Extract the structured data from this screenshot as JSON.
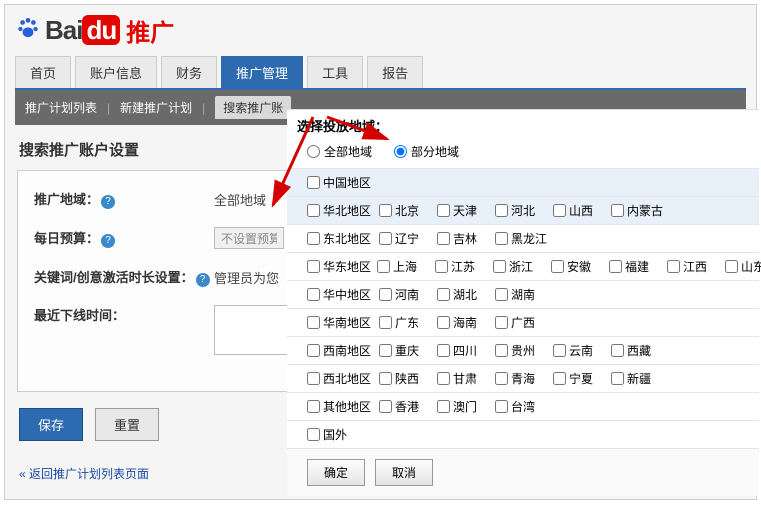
{
  "logo": {
    "bai": "Bai",
    "du": "du",
    "tuiguang": "推广"
  },
  "mainNav": [
    "首页",
    "账户信息",
    "财务",
    "推广管理",
    "工具",
    "报告"
  ],
  "mainNavActive": 3,
  "subNav": {
    "item1": "推广计划列表",
    "item2": "新建推广计划",
    "tab": "搜索推广账"
  },
  "sectionTitle": "搜索推广账户设置",
  "settings": {
    "regionLabel": "推广地域：",
    "regionValue": "全部地域",
    "budgetLabel": "每日预算：",
    "budgetValue": "不设置预算",
    "keywordLabel": "关键词/创意激活时长设置：",
    "keywordValue": "管理员为您",
    "offlineLabel": "最近下线时间："
  },
  "buttons": {
    "save": "保存",
    "reset": "重置"
  },
  "backLink": "« 返回推广计划列表页面",
  "popup": {
    "title": "选择投放地域：",
    "radioAll": "全部地域",
    "radioPart": "部分地域",
    "chinaRegion": "中国地区",
    "regions": [
      {
        "name": "华北地区",
        "cities": [
          "北京",
          "天津",
          "河北",
          "山西",
          "内蒙古"
        ]
      },
      {
        "name": "东北地区",
        "cities": [
          "辽宁",
          "吉林",
          "黑龙江"
        ]
      },
      {
        "name": "华东地区",
        "cities": [
          "上海",
          "江苏",
          "浙江",
          "安徽",
          "福建",
          "江西",
          "山东"
        ]
      },
      {
        "name": "华中地区",
        "cities": [
          "河南",
          "湖北",
          "湖南"
        ]
      },
      {
        "name": "华南地区",
        "cities": [
          "广东",
          "海南",
          "广西"
        ]
      },
      {
        "name": "西南地区",
        "cities": [
          "重庆",
          "四川",
          "贵州",
          "云南",
          "西藏"
        ]
      },
      {
        "name": "西北地区",
        "cities": [
          "陕西",
          "甘肃",
          "青海",
          "宁夏",
          "新疆"
        ]
      },
      {
        "name": "其他地区",
        "cities": [
          "香港",
          "澳门",
          "台湾"
        ]
      }
    ],
    "foreign": "国外",
    "ok": "确定",
    "cancel": "取消"
  }
}
